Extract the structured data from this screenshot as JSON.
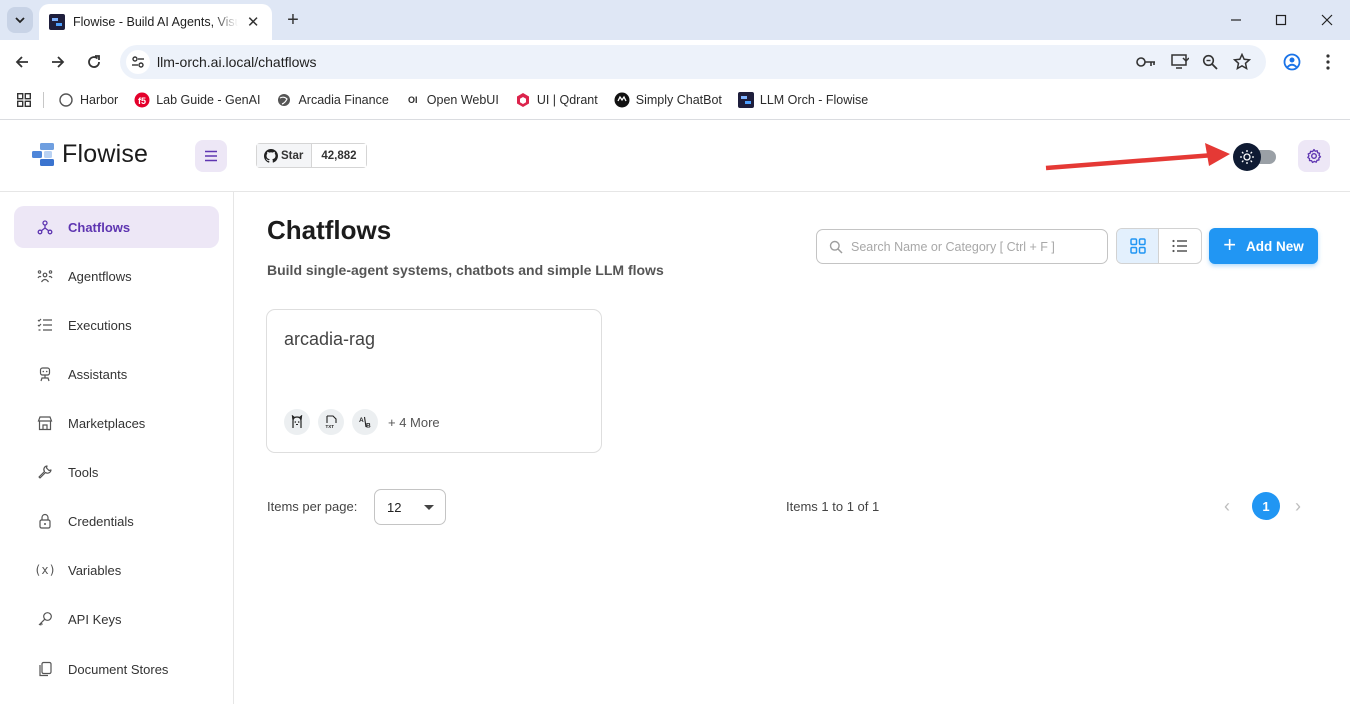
{
  "browser": {
    "tab_title": "Flowise - Build AI Agents, Visual",
    "url": "llm-orch.ai.local/chatflows",
    "bookmarks": [
      {
        "label": "Harbor"
      },
      {
        "label": "Lab Guide - GenAI"
      },
      {
        "label": "Arcadia Finance"
      },
      {
        "label": "Open WebUI"
      },
      {
        "label": "UI | Qdrant"
      },
      {
        "label": "Simply ChatBot"
      },
      {
        "label": "LLM Orch - Flowise"
      }
    ]
  },
  "header": {
    "brand": "Flowise",
    "github_star_label": "Star",
    "github_star_count": "42,882"
  },
  "sidebar": {
    "items": [
      {
        "label": "Chatflows",
        "icon": "chatflows-icon",
        "active": true
      },
      {
        "label": "Agentflows",
        "icon": "agentflows-icon"
      },
      {
        "label": "Executions",
        "icon": "executions-icon"
      },
      {
        "label": "Assistants",
        "icon": "assistants-icon"
      },
      {
        "label": "Marketplaces",
        "icon": "marketplaces-icon"
      },
      {
        "label": "Tools",
        "icon": "tools-icon"
      },
      {
        "label": "Credentials",
        "icon": "lock-icon"
      },
      {
        "label": "Variables",
        "icon": "variables-icon"
      },
      {
        "label": "API Keys",
        "icon": "key-icon"
      },
      {
        "label": "Document Stores",
        "icon": "document-stores-icon"
      }
    ]
  },
  "main": {
    "title": "Chatflows",
    "subtitle": "Build single-agent systems, chatbots and simple LLM flows",
    "search_placeholder": "Search Name or Category [ Ctrl + F ]",
    "add_button": "Add New",
    "cards": [
      {
        "name": "arcadia-rag",
        "more": "+ 4 More"
      }
    ],
    "pagination": {
      "items_per_page_label": "Items per page:",
      "items_per_page": "12",
      "range": "Items 1 to 1 of 1",
      "current_page": "1"
    }
  },
  "colors": {
    "accent_purple": "#5e35b1",
    "primary_blue": "#2196f3",
    "annotation_arrow": "#e53935"
  }
}
